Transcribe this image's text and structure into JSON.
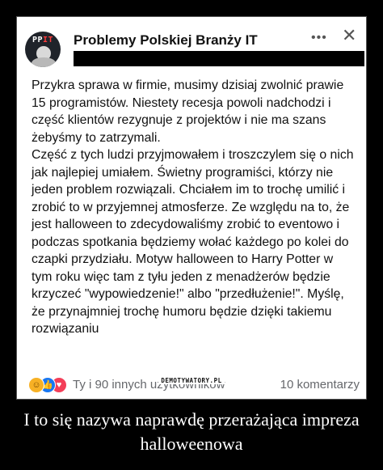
{
  "post": {
    "group_name": "Problemy Polskiej Branży IT",
    "avatar_text_pp": "PP",
    "avatar_text_it": "IT",
    "more_icon": "more-icon",
    "close_icon": "close-icon",
    "body": "Przykra sprawa w firmie, musimy dzisiaj zwolnić prawie 15 programistów. Niestety recesja powoli nadchodzi i część klientów rezygnuje z projektów i nie ma szans żebyśmy to zatrzymali.\nCzęść z tych ludzi przyjmowałem i troszczylem się o nich jak najlepiej umiałem. Świetny programiści, którzy nie jeden problem rozwiązali. Chciałem im to trochę umilić i zrobić to w przyjemnej atmosferze. Ze względu na to, że jest halloween to zdecydowaliśmy zrobić to eventowo i podczas spotkania będziemy wołać każdego po kolei do czapki przydziału. Motyw halloween to Harry Potter w tym roku więc tam z tyłu jeden z menadżerów będzie krzyczeć \"wypowiedzenie!\" albo \"przedłużenie!\". Myślę, że przynajmniej trochę humoru będzie dzięki takiemu rozwiązaniu",
    "reactions_icons": [
      "haha-reaction-icon",
      "like-reaction-icon",
      "love-reaction-icon"
    ],
    "reactions_text": "Ty i 90 innych użytkowników",
    "comments_text": "10 komentarzy"
  },
  "watermark": "DEMOTYWATORY.PL",
  "caption": "I to się nazywa naprawdę przerażająca impreza halloweenowa"
}
